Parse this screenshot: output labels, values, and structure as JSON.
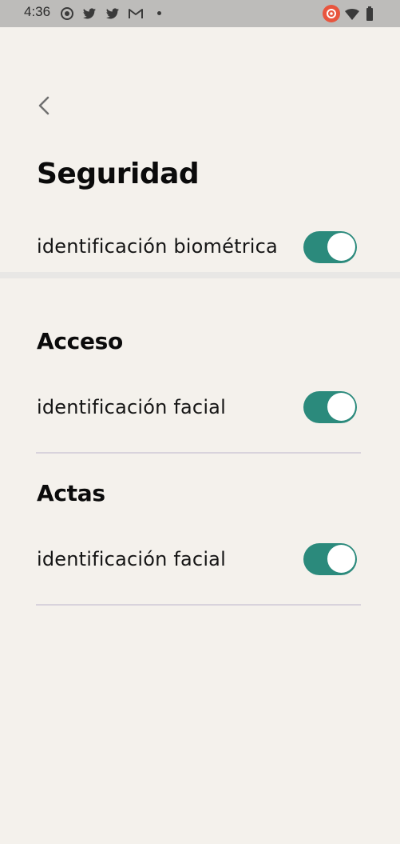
{
  "status_bar": {
    "time": "4:36",
    "icons": [
      "record-icon",
      "twitter-icon",
      "twitter-icon",
      "gmail-icon",
      "notification-dot",
      "cast-icon",
      "wifi-icon",
      "battery-icon"
    ]
  },
  "header": {
    "back_icon": "chevron-left-icon",
    "title": "Seguridad"
  },
  "biometric": {
    "label": "identificación biométrica",
    "enabled": true
  },
  "sections": [
    {
      "heading": "Acceso",
      "item_label": "identificación facial",
      "enabled": true
    },
    {
      "heading": "Actas",
      "item_label": "identificación facial",
      "enabled": true
    }
  ],
  "colors": {
    "background": "#f4f1ec",
    "toggle_on": "#2b8a7c",
    "status_bar": "#bdbcba",
    "cast_accent": "#e8553e"
  }
}
